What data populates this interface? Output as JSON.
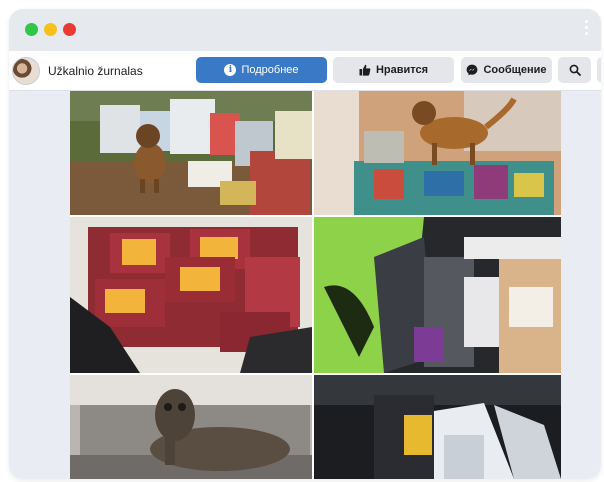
{
  "window": {
    "controls": [
      "green",
      "yellow",
      "red"
    ]
  },
  "page": {
    "name": "Užkalnio žurnalas",
    "avatar_icon": "profile-avatar"
  },
  "actions": {
    "more_label": "Подробнее",
    "like_label": "Нравится",
    "message_label": "Сообщение",
    "more_icon": "info-icon",
    "like_icon": "thumbs-up-icon",
    "message_icon": "messenger-icon",
    "search_icon": "search-icon"
  },
  "colors": {
    "primary": "#3a79c6",
    "button_bg": "#e4e6ea",
    "frame": "#e9edf3"
  },
  "photos": [
    {
      "subject": "dog-with-pet-food-bags"
    },
    {
      "subject": "dog-on-pile-of-food-bags"
    },
    {
      "subject": "raw-meat-packages"
    },
    {
      "subject": "green-bag-and-boxes"
    },
    {
      "subject": "dog-on-sofa"
    },
    {
      "subject": "bags-in-car"
    }
  ]
}
